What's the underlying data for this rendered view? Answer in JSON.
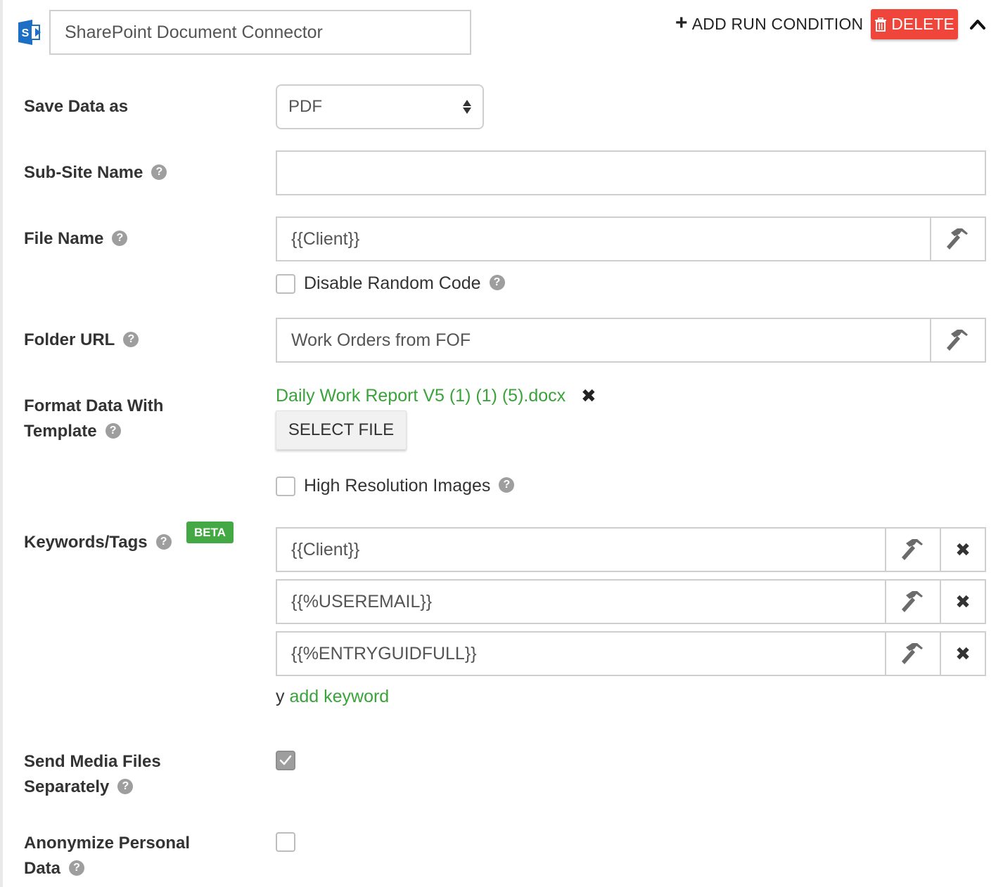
{
  "connector": {
    "icon": "sharepoint-icon",
    "name": "SharePoint Document Connector"
  },
  "header": {
    "add_run_condition": "ADD RUN CONDITION",
    "delete": "DELETE",
    "delete_color": "#f0453a"
  },
  "fields": {
    "save_data_as": {
      "label": "Save Data as",
      "value": "PDF"
    },
    "sub_site_name": {
      "label": "Sub-Site Name",
      "value": ""
    },
    "file_name": {
      "label": "File Name",
      "value": "{{Client}}"
    },
    "disable_random_code": {
      "label": "Disable Random Code",
      "checked": false
    },
    "folder_url": {
      "label": "Folder URL",
      "value": "Work Orders from FOF"
    },
    "format_template": {
      "label_line1": "Format Data With",
      "label_line2": "Template",
      "file": "Daily Work Report V5 (1) (1) (5).docx",
      "select_file": "SELECT FILE"
    },
    "high_res_images": {
      "label": "High Resolution Images",
      "checked": false
    },
    "keywords": {
      "label": "Keywords/Tags",
      "badge": "BETA",
      "items": [
        "{{Client}}",
        "{{%USEREMAIL}}",
        "{{%ENTRYGUIDFULL}}"
      ],
      "prefix": "y",
      "add_label": "add keyword"
    },
    "send_media": {
      "label_line1": "Send Media Files",
      "label_line2": "Separately",
      "checked": true
    },
    "anonymize": {
      "label_line1": "Anonymize Personal",
      "label_line2": "Data",
      "checked": false
    }
  },
  "help_glyph": "?",
  "accent_green": "#3aa33a"
}
